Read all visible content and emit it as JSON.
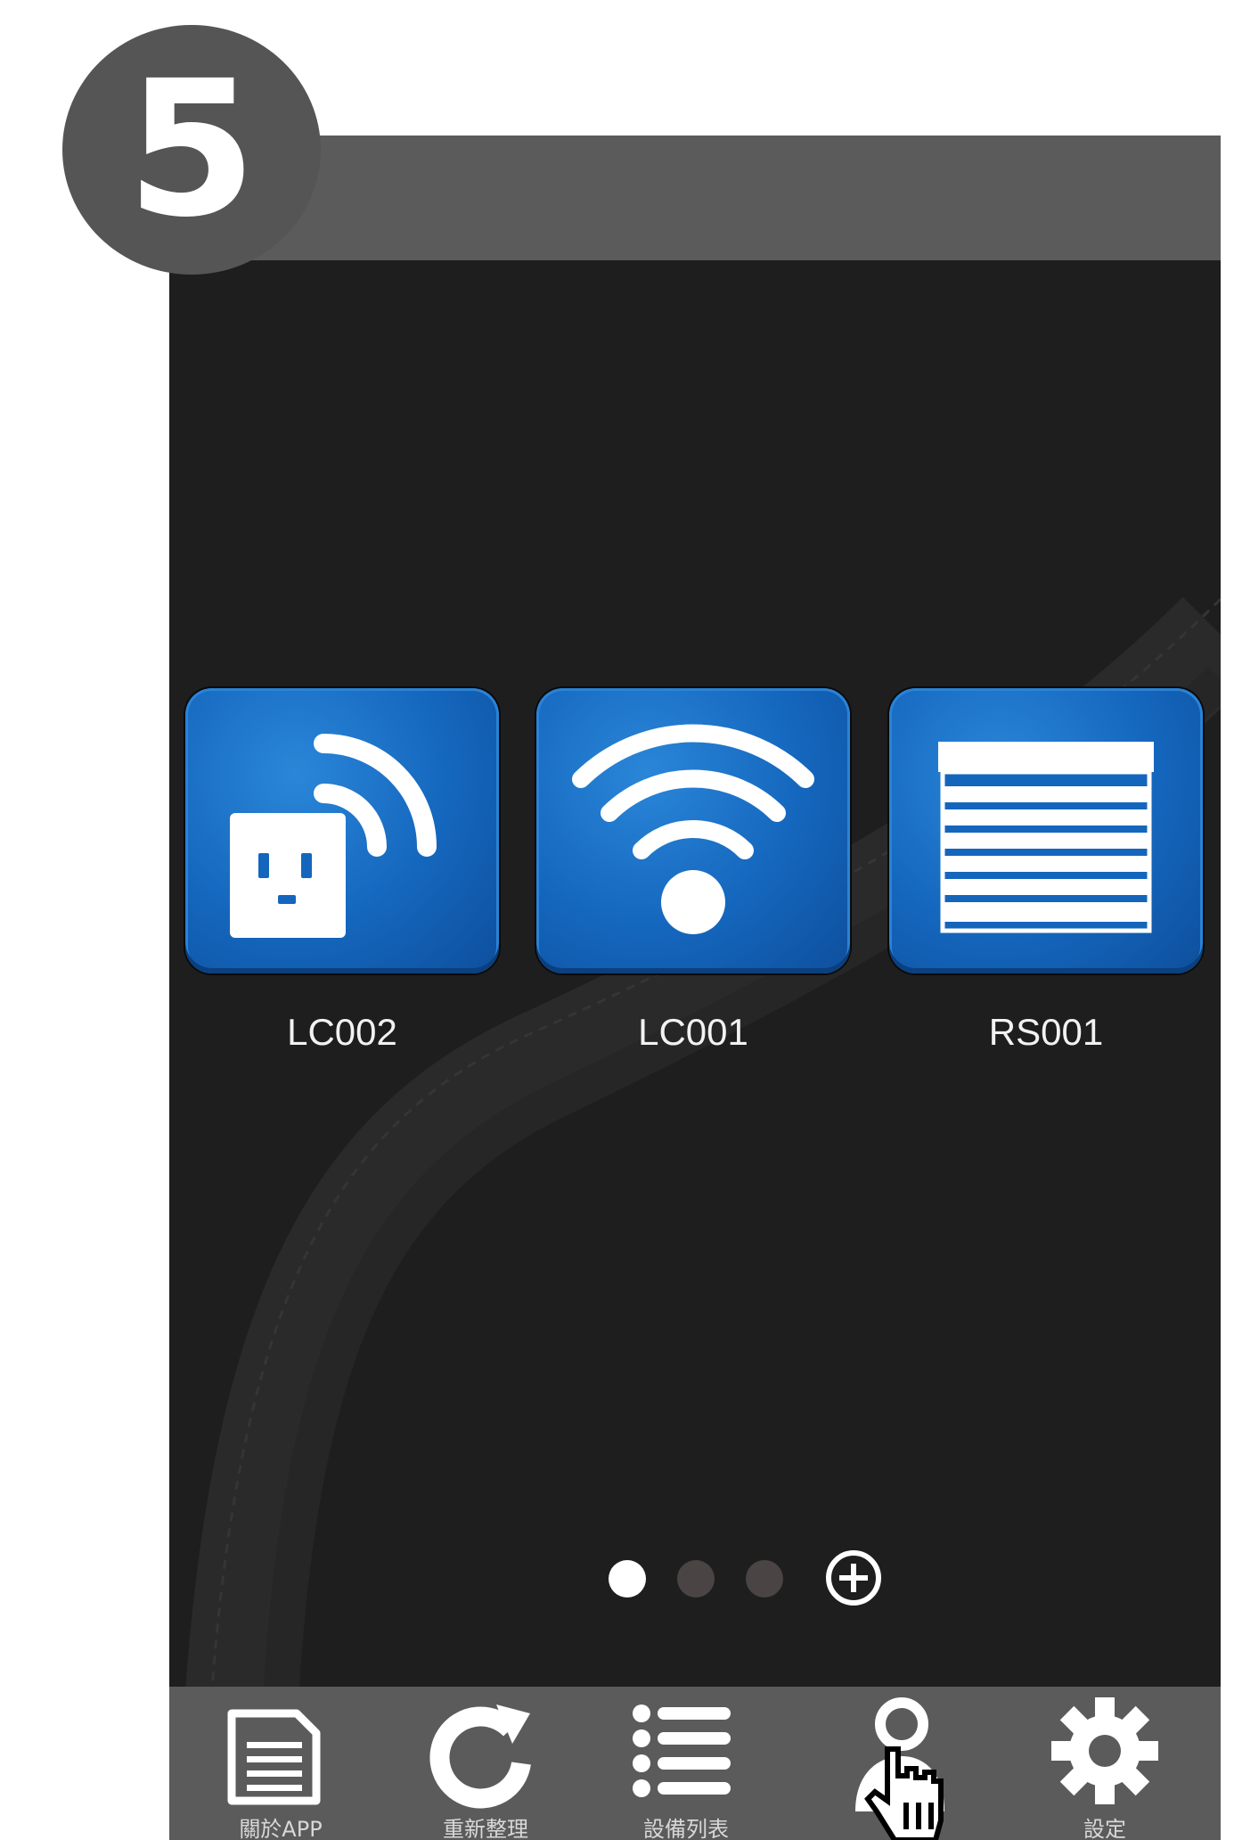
{
  "step": {
    "number": "5"
  },
  "devices": [
    {
      "name": "LC002",
      "icon": "smart-plug-icon"
    },
    {
      "name": "LC001",
      "icon": "wifi-icon"
    },
    {
      "name": "RS001",
      "icon": "roller-shutter-icon"
    }
  ],
  "pager": {
    "pages": 3,
    "active_index": 0,
    "add_icon": "plus-circle-icon"
  },
  "bottom_nav": [
    {
      "label": "關於APP",
      "icon": "document-icon"
    },
    {
      "label": "重新整理",
      "icon": "refresh-icon"
    },
    {
      "label": "設備列表",
      "icon": "list-icon"
    },
    {
      "label": "",
      "icon": "user-icon"
    },
    {
      "label": "設定",
      "icon": "gear-icon"
    }
  ],
  "colors": {
    "tile_blue": "#1466bd",
    "bar_gray": "#5b5b5b",
    "background": "#1e1e1e"
  }
}
